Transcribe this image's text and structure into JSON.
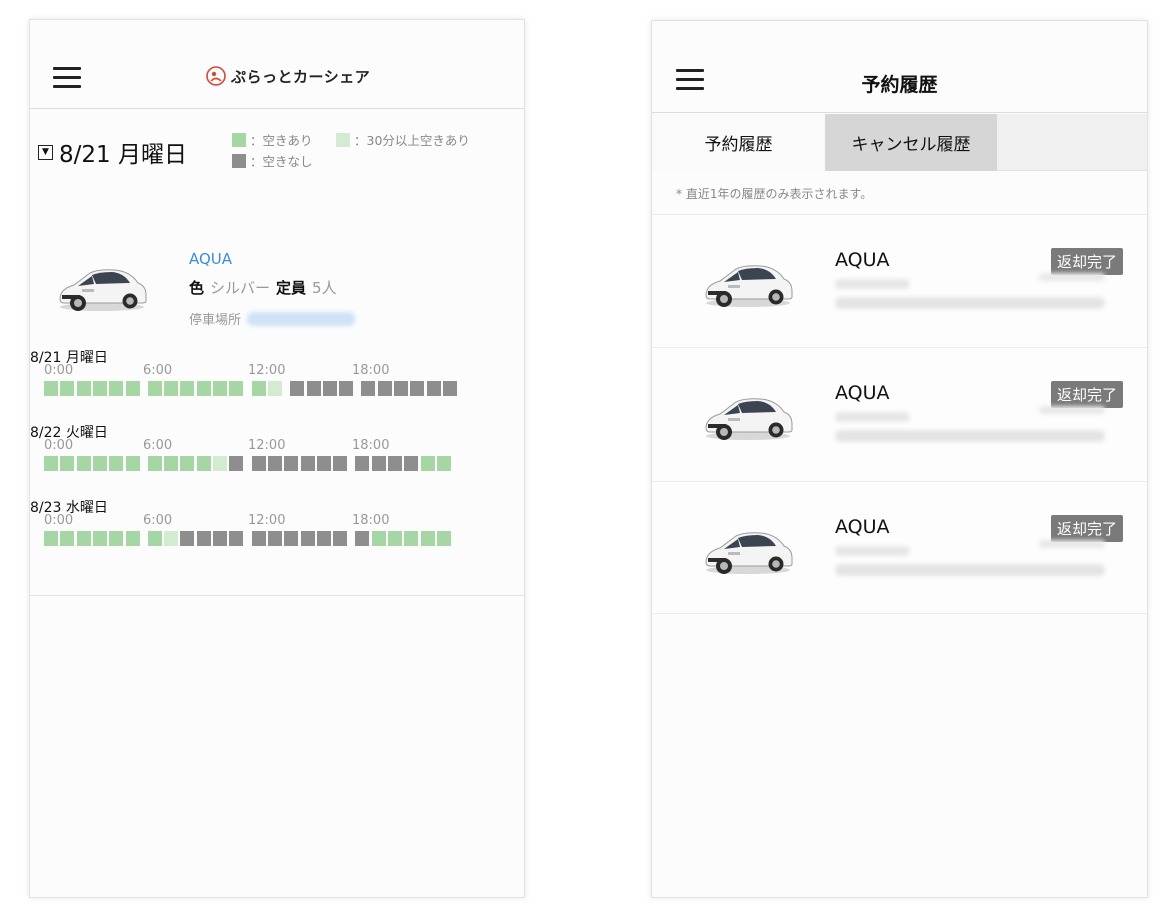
{
  "colors": {
    "available": "#a6d6a4",
    "available_30min": "#d2ebd1",
    "unavailable": "#8e8e8e",
    "link_blue": "#3a8ed6",
    "badge": "#7a7a7a"
  },
  "left_screen": {
    "header": {
      "menu_icon": "hamburger-icon",
      "logo_text": "ぷらっとカーシェア"
    },
    "date_selector": {
      "icon": "dropdown-box-icon",
      "label": "8/21 月曜日"
    },
    "legend": {
      "available": "：空きあり",
      "available_30min": "：30分以上空きあり",
      "unavailable": "：空きなし"
    },
    "car": {
      "name": "AQUA",
      "color_label": "色",
      "color_value": "シルバー",
      "capacity_label": "定員",
      "capacity_value": "5人",
      "parking_label": "停車場所"
    },
    "time_labels": [
      "0:00",
      "6:00",
      "12:00",
      "18:00"
    ],
    "days": [
      {
        "date": "8/21 月曜日",
        "slots": "AAAAAA AAAAAA AT UUUU UUUUUU"
      },
      {
        "date": "8/22 火曜日",
        "slots": "AAAAAA AAAATU UUUUUU UUUUAA"
      },
      {
        "date": "8/23 水曜日",
        "slots": "AAAAAA ATUUUU UUUUUU UAAAAA"
      }
    ]
  },
  "right_screen": {
    "header": {
      "menu_icon": "hamburger-icon",
      "title": "予約履歴"
    },
    "tabs": [
      {
        "label": "予約履歴",
        "active": false
      },
      {
        "label": "キャンセル履歴",
        "active": true
      }
    ],
    "note": "* 直近1年の履歴のみ表示されます。",
    "reservations": [
      {
        "car_name": "AQUA",
        "status": "返却完了"
      },
      {
        "car_name": "AQUA",
        "status": "返却完了"
      },
      {
        "car_name": "AQUA",
        "status": "返却完了"
      }
    ]
  }
}
